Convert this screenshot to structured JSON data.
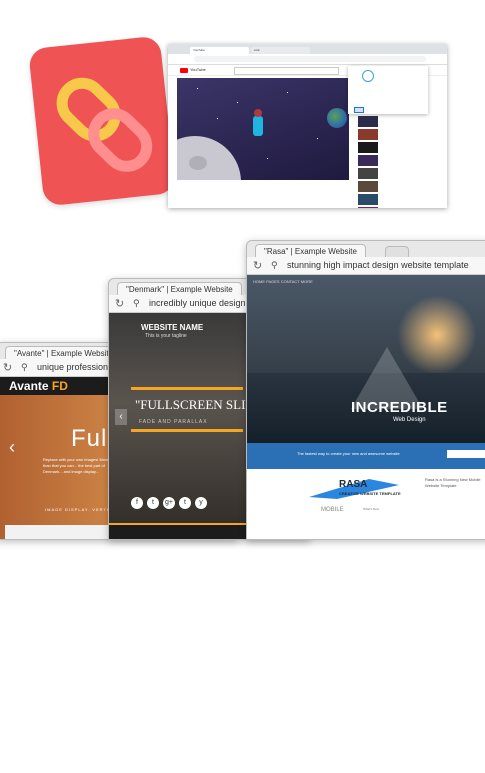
{
  "youtube_screenshot": {
    "tabs": [
      "YouTube",
      "Link"
    ],
    "address": "",
    "yt_word": "YouTube",
    "search_text": "",
    "video_title": "",
    "video_meta": "",
    "actions_text": "",
    "channel": "",
    "popup_label": "",
    "popup_link": "",
    "suggestions": [
      "",
      "",
      "",
      "",
      "",
      "",
      "",
      "",
      ""
    ]
  },
  "avante_window": {
    "tab_title": "\"Avante\" | Example Website",
    "address": "unique professional",
    "brand_main": "Avante",
    "brand_accent": "FD",
    "hero_text": "Fulls",
    "desc": "Replace with your own images! More than that you can... the best part of Denmark... and image display...",
    "small_text": "IMAGE DISPLAY. VERTICAL"
  },
  "denmark_window": {
    "tab_title": "\"Denmark\" | Example Website",
    "address": "incredibly unique design",
    "site_name": "WEBSITE NAME",
    "tagline": "This is your tagline",
    "slider_title": "\"FULLSCREEN SLIDER\"",
    "fade_text": "FADE AND PARALLAX",
    "social_icons": [
      "f",
      "t",
      "g+",
      "t",
      "y"
    ]
  },
  "rasa_window": {
    "tab_title": "\"Rasa\" | Example Website",
    "address": "stunning high impact design website template",
    "nav_text": "HOME    PAGES    CONTACT    MORE",
    "hero_big": "INCREDIBLE",
    "hero_sub": "Web Design",
    "blue_bar_text": "The fastest way to create your new and awesome website",
    "logo_text": "RASA",
    "logo_sub": "CREATIVE WEBSITE TEMPLATE",
    "mobile_label": "MOBILE",
    "desc": "Rasa is a Stunning New Mobile Website Template",
    "col_text": "What's New"
  },
  "colors": {
    "app_icon": "#ef5354",
    "accent_orange": "#f5a623",
    "rasa_blue": "#2b6fb5"
  }
}
